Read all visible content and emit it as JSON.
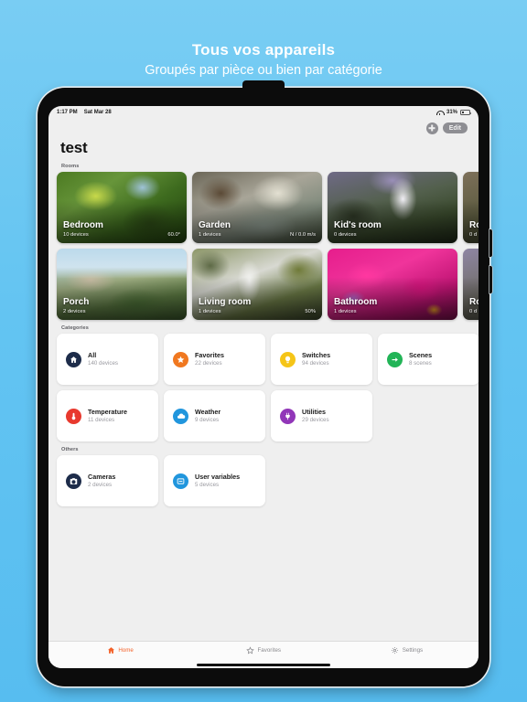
{
  "promo": {
    "title": "Tous vos appareils",
    "subtitle": "Groupés par pièce ou bien par catégorie"
  },
  "statusbar": {
    "time": "1:17 PM",
    "date": "Sat Mar 28",
    "battery_percent": "31%",
    "wifi_icon": "wifi-icon",
    "battery_icon": "battery-icon"
  },
  "nav": {
    "add_label": "+",
    "edit_label": "Edit"
  },
  "page": {
    "title": "test"
  },
  "sections": {
    "rooms_label": "Rooms",
    "categories_label": "Categories",
    "others_label": "Others"
  },
  "rooms": [
    {
      "name": "Bedroom",
      "devices": "10 devices",
      "value": "60.0°",
      "photo": "ph-bedroom"
    },
    {
      "name": "Garden",
      "devices": "1 devices",
      "value": "N / 0.0 m/s",
      "photo": "ph-garden"
    },
    {
      "name": "Kid's room",
      "devices": "0 devices",
      "value": "",
      "photo": "ph-kids"
    },
    {
      "name": "Ro",
      "devices": "0 d",
      "value": "",
      "photo": "ph-roof"
    },
    {
      "name": "Porch",
      "devices": "2 devices",
      "value": "",
      "photo": "ph-porch"
    },
    {
      "name": "Living room",
      "devices": "1 devices",
      "value": "50%",
      "photo": "ph-living"
    },
    {
      "name": "Bathroom",
      "devices": "1 devices",
      "value": "",
      "photo": "ph-bath"
    },
    {
      "name": "Ro",
      "devices": "0 d",
      "value": "",
      "photo": "ph-roof2"
    }
  ],
  "categories": [
    {
      "name": "All",
      "sub": "140 devices",
      "icon": "home-icon",
      "color": "#1d2c4a"
    },
    {
      "name": "Favorites",
      "sub": "22 devices",
      "icon": "star-icon",
      "color": "#f07820"
    },
    {
      "name": "Switches",
      "sub": "94 devices",
      "icon": "lightbulb-icon",
      "color": "#f5c518"
    },
    {
      "name": "Scenes",
      "sub": "8 scenes",
      "icon": "arrow-right-icon",
      "color": "#22b457"
    },
    {
      "name": "Temperature",
      "sub": "11 devices",
      "icon": "thermometer-icon",
      "color": "#e8392e"
    },
    {
      "name": "Weather",
      "sub": "9 devices",
      "icon": "cloud-icon",
      "color": "#2196dd"
    },
    {
      "name": "Utilities",
      "sub": "29 devices",
      "icon": "plug-icon",
      "color": "#9136b8"
    }
  ],
  "others": [
    {
      "name": "Cameras",
      "sub": "2 devices",
      "icon": "camera-icon",
      "color": "#1d2c4a"
    },
    {
      "name": "User variables",
      "sub": "5 devices",
      "icon": "variable-icon",
      "color": "#2196dd"
    }
  ],
  "tabs": [
    {
      "label": "Home",
      "icon": "home-icon",
      "active": true
    },
    {
      "label": "Favorites",
      "icon": "star-icon",
      "active": false
    },
    {
      "label": "Settings",
      "icon": "gear-icon",
      "active": false
    }
  ],
  "colors": {
    "background_top": "#79cdf3",
    "background_bottom": "#57bdf0",
    "accent": "#f4622a",
    "screen_bg": "#efefef"
  }
}
